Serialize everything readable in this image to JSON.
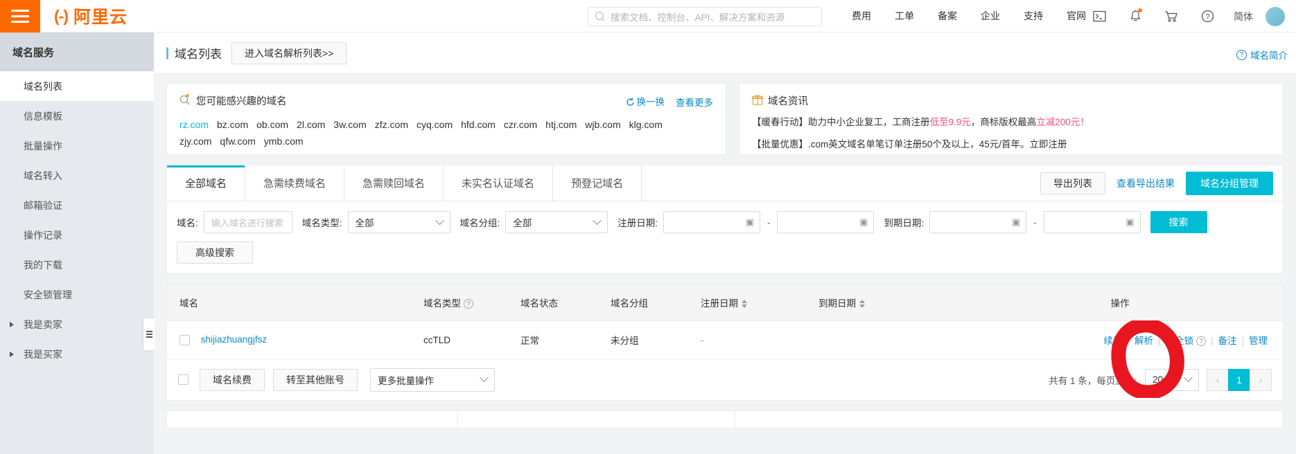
{
  "topbar": {
    "logo_text": "阿里云",
    "search_placeholder": "搜索文档、控制台、API、解决方案和资源",
    "nav": [
      {
        "label": "费用"
      },
      {
        "label": "工单"
      },
      {
        "label": "备案"
      },
      {
        "label": "企业"
      },
      {
        "label": "支持"
      },
      {
        "label": "官网"
      }
    ],
    "language": "简体"
  },
  "sidebar": {
    "title": "域名服务",
    "items": [
      {
        "label": "域名列表",
        "active": true,
        "expandable": false
      },
      {
        "label": "信息模板",
        "active": false,
        "expandable": false
      },
      {
        "label": "批量操作",
        "active": false,
        "expandable": false
      },
      {
        "label": "域名转入",
        "active": false,
        "expandable": false
      },
      {
        "label": "邮箱验证",
        "active": false,
        "expandable": false
      },
      {
        "label": "操作记录",
        "active": false,
        "expandable": false
      },
      {
        "label": "我的下载",
        "active": false,
        "expandable": false
      },
      {
        "label": "安全锁管理",
        "active": false,
        "expandable": false
      },
      {
        "label": "我是卖家",
        "active": false,
        "expandable": true
      },
      {
        "label": "我是买家",
        "active": false,
        "expandable": true
      }
    ]
  },
  "page_head": {
    "title": "域名列表",
    "resolve_button": "进入域名解析列表>>",
    "help_link": "域名简介"
  },
  "recommend_panel": {
    "heading": "您可能感兴趣的域名",
    "refresh_label": "换一换",
    "more_label": "查看更多",
    "domains": [
      {
        "name": "rz.com",
        "hot": true
      },
      {
        "name": "bz.com",
        "hot": false
      },
      {
        "name": "ob.com",
        "hot": false
      },
      {
        "name": "2l.com",
        "hot": false
      },
      {
        "name": "3w.com",
        "hot": false
      },
      {
        "name": "zfz.com",
        "hot": false
      },
      {
        "name": "cyq.com",
        "hot": false
      },
      {
        "name": "hfd.com",
        "hot": false
      },
      {
        "name": "czr.com",
        "hot": false
      },
      {
        "name": "htj.com",
        "hot": false
      },
      {
        "name": "wjb.com",
        "hot": false
      },
      {
        "name": "klg.com",
        "hot": false
      },
      {
        "name": "zjy.com",
        "hot": false
      },
      {
        "name": "qfw.com",
        "hot": false
      },
      {
        "name": "ymb.com",
        "hot": false
      }
    ]
  },
  "news_panel": {
    "heading": "域名资讯",
    "line1_a": "【暖春行动】助力中小企业复工，工商注册",
    "line1_hl1": "低至9.9元",
    "line1_b": "，商标版权最高",
    "line1_hl2": "立减200元",
    "line1_c": "！",
    "line2": "【批量优惠】.com英文域名单笔订单注册50个及以上，45元/首年。立即注册"
  },
  "tabs": [
    {
      "label": "全部域名",
      "active": true
    },
    {
      "label": "急需续费域名",
      "active": false
    },
    {
      "label": "急需赎回域名",
      "active": false
    },
    {
      "label": "未实名认证域名",
      "active": false
    },
    {
      "label": "预登记域名",
      "active": false
    }
  ],
  "tab_actions": {
    "export_list": "导出列表",
    "view_export_result": "查看导出结果",
    "group_manage": "域名分组管理"
  },
  "filters": {
    "domain_label": "域名:",
    "domain_placeholder": "输入域名进行搜索",
    "domain_value": "",
    "type_label": "域名类型:",
    "type_value": "全部",
    "group_label": "域名分组:",
    "group_value": "全部",
    "reg_date_label": "注册日期:",
    "reg_date_from": "",
    "reg_date_to": "",
    "exp_date_label": "到期日期:",
    "exp_date_from": "",
    "exp_date_to": "",
    "range_separator": "-",
    "search_button": "搜索",
    "advanced_button": "高级搜索"
  },
  "table": {
    "columns": [
      {
        "label": "域名",
        "help": false,
        "sortable": false
      },
      {
        "label": "域名类型",
        "help": true,
        "sortable": false
      },
      {
        "label": "域名状态",
        "help": false,
        "sortable": false
      },
      {
        "label": "域名分组",
        "help": false,
        "sortable": false
      },
      {
        "label": "注册日期",
        "help": false,
        "sortable": true
      },
      {
        "label": "到期日期",
        "help": false,
        "sortable": true
      },
      {
        "label": "操作",
        "help": false,
        "sortable": false
      }
    ],
    "rows": [
      {
        "domain": "shijiazhuangjfsz",
        "type": "ccTLD",
        "status": "正常",
        "group": "未分组",
        "reg_date": "-",
        "exp_date": "",
        "actions": [
          "续费",
          "解析",
          "安全锁",
          "备注",
          "管理"
        ]
      }
    ]
  },
  "bulk_bar": {
    "renew": "域名续费",
    "transfer": "转至其他账号",
    "more": "更多批量操作"
  },
  "pagination": {
    "summary": "共有 1 条，每页显示:",
    "page_size": "20",
    "prev": "‹",
    "current_page": "1",
    "next": "›"
  },
  "annotation": {
    "shape": "hand-drawn-red-circle",
    "target": "解析",
    "color": "#e8161f"
  },
  "colors": {
    "brand_orange": "#ff6a00",
    "accent_cyan": "#00bcd4",
    "link_blue": "#0a8ac7",
    "highlight_pink": "#f0507a"
  }
}
